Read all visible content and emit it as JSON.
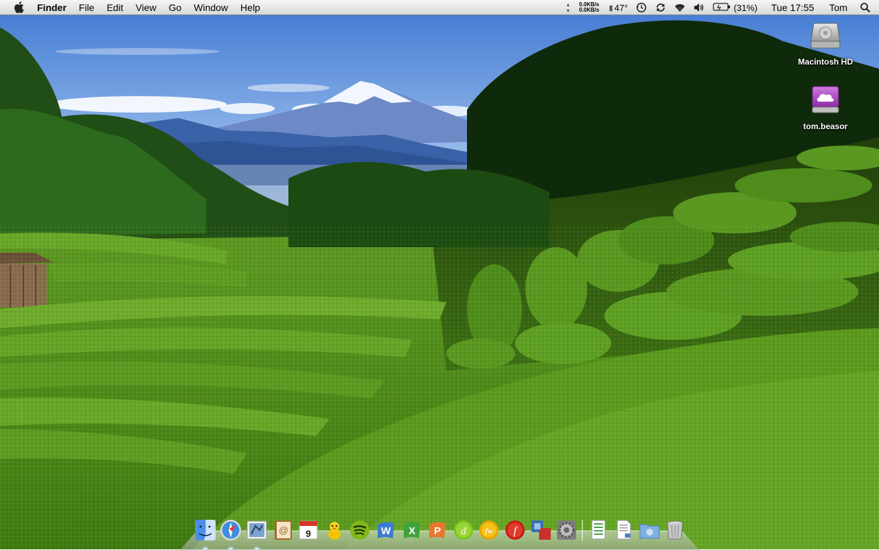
{
  "menubar": {
    "app_name": "Finder",
    "menus": [
      "File",
      "Edit",
      "View",
      "Go",
      "Window",
      "Help"
    ],
    "netstat": {
      "upload": "0.0KB/s",
      "download": "0.0KB/s"
    },
    "temperature": "47°",
    "battery": "(31%)",
    "clock": "Tue 17:55",
    "user": "Tom",
    "status_icons": [
      "time-machine-icon",
      "sync-icon",
      "wifi-icon",
      "volume-icon",
      "battery-icon",
      "spotlight-icon"
    ]
  },
  "desktop": {
    "icons": [
      {
        "label": "Macintosh HD",
        "icon": "hard-drive-icon"
      },
      {
        "label": "tom.beasor",
        "icon": "idisk-icon"
      }
    ]
  },
  "dock": {
    "apps": [
      {
        "name": "Finder",
        "icon": "finder-icon",
        "running": true
      },
      {
        "name": "Safari",
        "icon": "safari-icon",
        "running": true
      },
      {
        "name": "Mail",
        "icon": "mail-icon",
        "running": true
      },
      {
        "name": "Address Book",
        "icon": "address-book-icon",
        "running": false
      },
      {
        "name": "iCal",
        "icon": "ical-icon",
        "running": false,
        "date": "9"
      },
      {
        "name": "Adium",
        "icon": "adium-icon",
        "running": false
      },
      {
        "name": "Spotify",
        "icon": "spotify-icon",
        "running": false
      },
      {
        "name": "Word",
        "icon": "word-icon",
        "running": false
      },
      {
        "name": "Excel",
        "icon": "excel-icon",
        "running": false
      },
      {
        "name": "PowerPoint",
        "icon": "powerpoint-icon",
        "running": false
      },
      {
        "name": "Dreamweaver",
        "icon": "dreamweaver-icon",
        "running": false
      },
      {
        "name": "Fireworks",
        "icon": "fireworks-icon",
        "running": false
      },
      {
        "name": "Flash",
        "icon": "flash-icon",
        "running": false
      },
      {
        "name": "VMware Fusion",
        "icon": "vmware-icon",
        "running": false
      },
      {
        "name": "System Preferences",
        "icon": "system-preferences-icon",
        "running": false
      }
    ],
    "stacks": [
      {
        "name": "Documents",
        "icon": "documents-stack-icon"
      },
      {
        "name": "Downloads",
        "icon": "downloads-stack-icon"
      },
      {
        "name": "Applications",
        "icon": "applications-folder-icon"
      },
      {
        "name": "Trash",
        "icon": "trash-icon"
      }
    ]
  },
  "colors": {
    "sky": "#5b8fd6",
    "tea_green": "#4f8a1f",
    "menubar": "#e8e8e8",
    "idisk_purple": "#b04cc8"
  }
}
